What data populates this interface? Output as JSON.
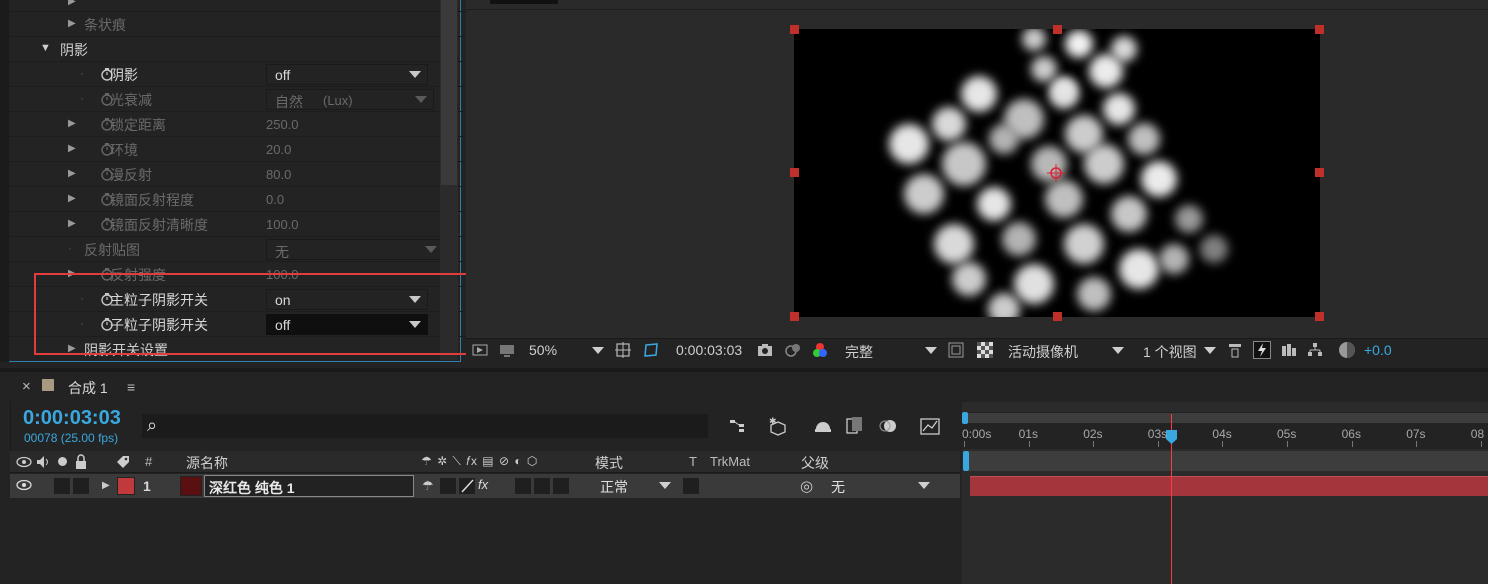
{
  "effects": {
    "rows": [
      {
        "label": "条状痕",
        "dim": true
      },
      {
        "label": "阴影",
        "dim": false
      },
      {
        "label": "阴影",
        "value": "off"
      },
      {
        "label": "光衰减",
        "value": "自然",
        "unit": "(Lux)"
      },
      {
        "label": "锁定距离",
        "value": "250.0"
      },
      {
        "label": "环境",
        "value": "20.0"
      },
      {
        "label": "漫反射",
        "value": "80.0"
      },
      {
        "label": "镜面反射程度",
        "value": "0.0"
      },
      {
        "label": "镜面反射清晰度",
        "value": "100.0"
      },
      {
        "label": "反射贴图",
        "value": "无"
      },
      {
        "label": "反射强度",
        "value": "100.0"
      },
      {
        "label": "主粒子阴影开关",
        "value": "on"
      },
      {
        "label": "子粒子阴影开关",
        "value": "off"
      },
      {
        "label": "阴影开关设置"
      }
    ]
  },
  "viewer": {
    "zoom": "50%",
    "timecode": "0:00:03:03",
    "resolution": "完整",
    "camera": "活动摄像机",
    "views": "1 个视图",
    "exposure": "+0.0"
  },
  "timeline": {
    "close": "×",
    "comp_name": "合成 1",
    "menu": "≡",
    "current_time": "0:00:03:03",
    "frame_info": "00078 (25.00 fps)",
    "search_icon": "⌕",
    "columns": {
      "number": "#",
      "source_name": "源名称",
      "mode": "模式",
      "t": "T",
      "trkmat": "TrkMat",
      "parent": "父级"
    },
    "layer": {
      "index": "1",
      "name": "深红色 纯色 1",
      "mode": "正常",
      "parent": "无",
      "label_color": "#c0393b",
      "swatch_color": "#5a0f10"
    },
    "ruler": [
      "0:00s",
      "01s",
      "02s",
      "03s",
      "04s",
      "05s",
      "06s",
      "07s",
      "08"
    ]
  },
  "colors": {
    "accent_blue": "#3aa8e0",
    "highlight_red": "#e23c3c",
    "layer_bar": "#a5353c"
  }
}
